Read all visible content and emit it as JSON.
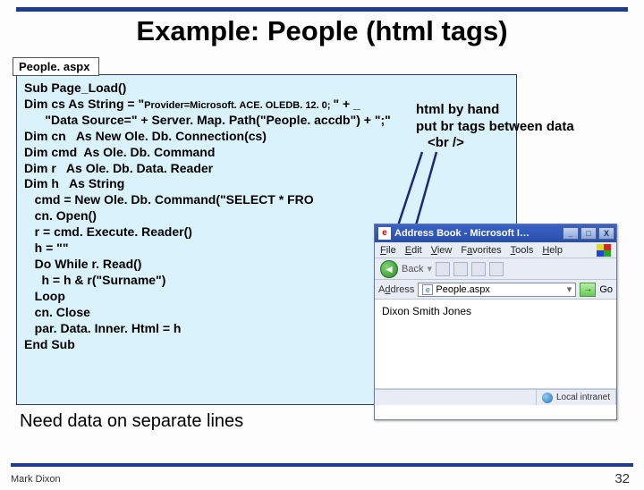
{
  "title": "Example: People (html tags)",
  "tab_label": "People. aspx",
  "code_lines": {
    "l1": "Sub Page_Load()",
    "l2a": "Dim cs As String = \"",
    "l2b": "Provider=Microsoft. ACE. OLEDB. 12. 0; ",
    "l2c": "\" + _",
    "l3": "      \"Data Source=\" + Server. Map. Path(\"People. accdb\") + \";\"",
    "l4": "Dim cn   As New Ole. Db. Connection(cs)",
    "l5": "Dim cmd  As Ole. Db. Command",
    "l6": "Dim r   As Ole. Db. Data. Reader",
    "l7": "Dim h   As String",
    "l8": "   cmd = New Ole. Db. Command(\"SELECT * FRO",
    "l9": "   cn. Open()",
    "l10": "   r = cmd. Execute. Reader()",
    "l11": "   h = \"\"",
    "l12": "   Do While r. Read()",
    "l13": "     h = h & r(\"Surname\")",
    "l14": "   Loop",
    "l15": "   cn. Close",
    "l16": "   par. Data. Inner. Html = h",
    "l17": "End Sub"
  },
  "annotations": {
    "a1": "html by hand",
    "a2": "put br tags between data",
    "a3": "<br />"
  },
  "below_text": "Need data on separate lines",
  "footer": {
    "left": "Mark Dixon",
    "right": "32"
  },
  "browser": {
    "title": "Address Book - Microsoft I…",
    "menus": {
      "file": "File",
      "edit": "Edit",
      "view": "View",
      "fav": "Favorites",
      "tools": "Tools",
      "help": "Help"
    },
    "toolbar": {
      "back": "Back"
    },
    "address_label": "Address",
    "address_value": "People.aspx",
    "go_label": "Go",
    "content": "Dixon Smith Jones",
    "status": "Local intranet",
    "winbuttons": {
      "min": "_",
      "max": "□",
      "close": "X"
    }
  }
}
